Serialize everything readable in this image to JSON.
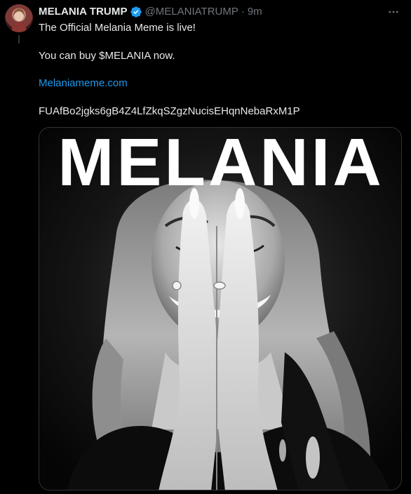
{
  "post": {
    "author": {
      "display_name": "MELANIA TRUMP",
      "handle": "@MELANIATRUMP",
      "verified": true
    },
    "separator": "·",
    "timestamp": "9m",
    "lines": [
      "The Official Melania Meme is live!",
      "You can buy $MELANIA now.",
      "Melaniameme.com",
      "FUAfBo2jgks6gB4Z4LfZkqSZgzNucisEHqnNebaRxM1P"
    ],
    "media": {
      "overlay_text": "MELANIA"
    },
    "more_icon": "more-dots-icon",
    "verified_icon": "verified-badge-icon"
  },
  "colors": {
    "background": "#000000",
    "text": "#e7e9ea",
    "muted": "#71767b",
    "link": "#1d9bf0",
    "verified": "#1d9bf0",
    "border": "#2f3336"
  }
}
